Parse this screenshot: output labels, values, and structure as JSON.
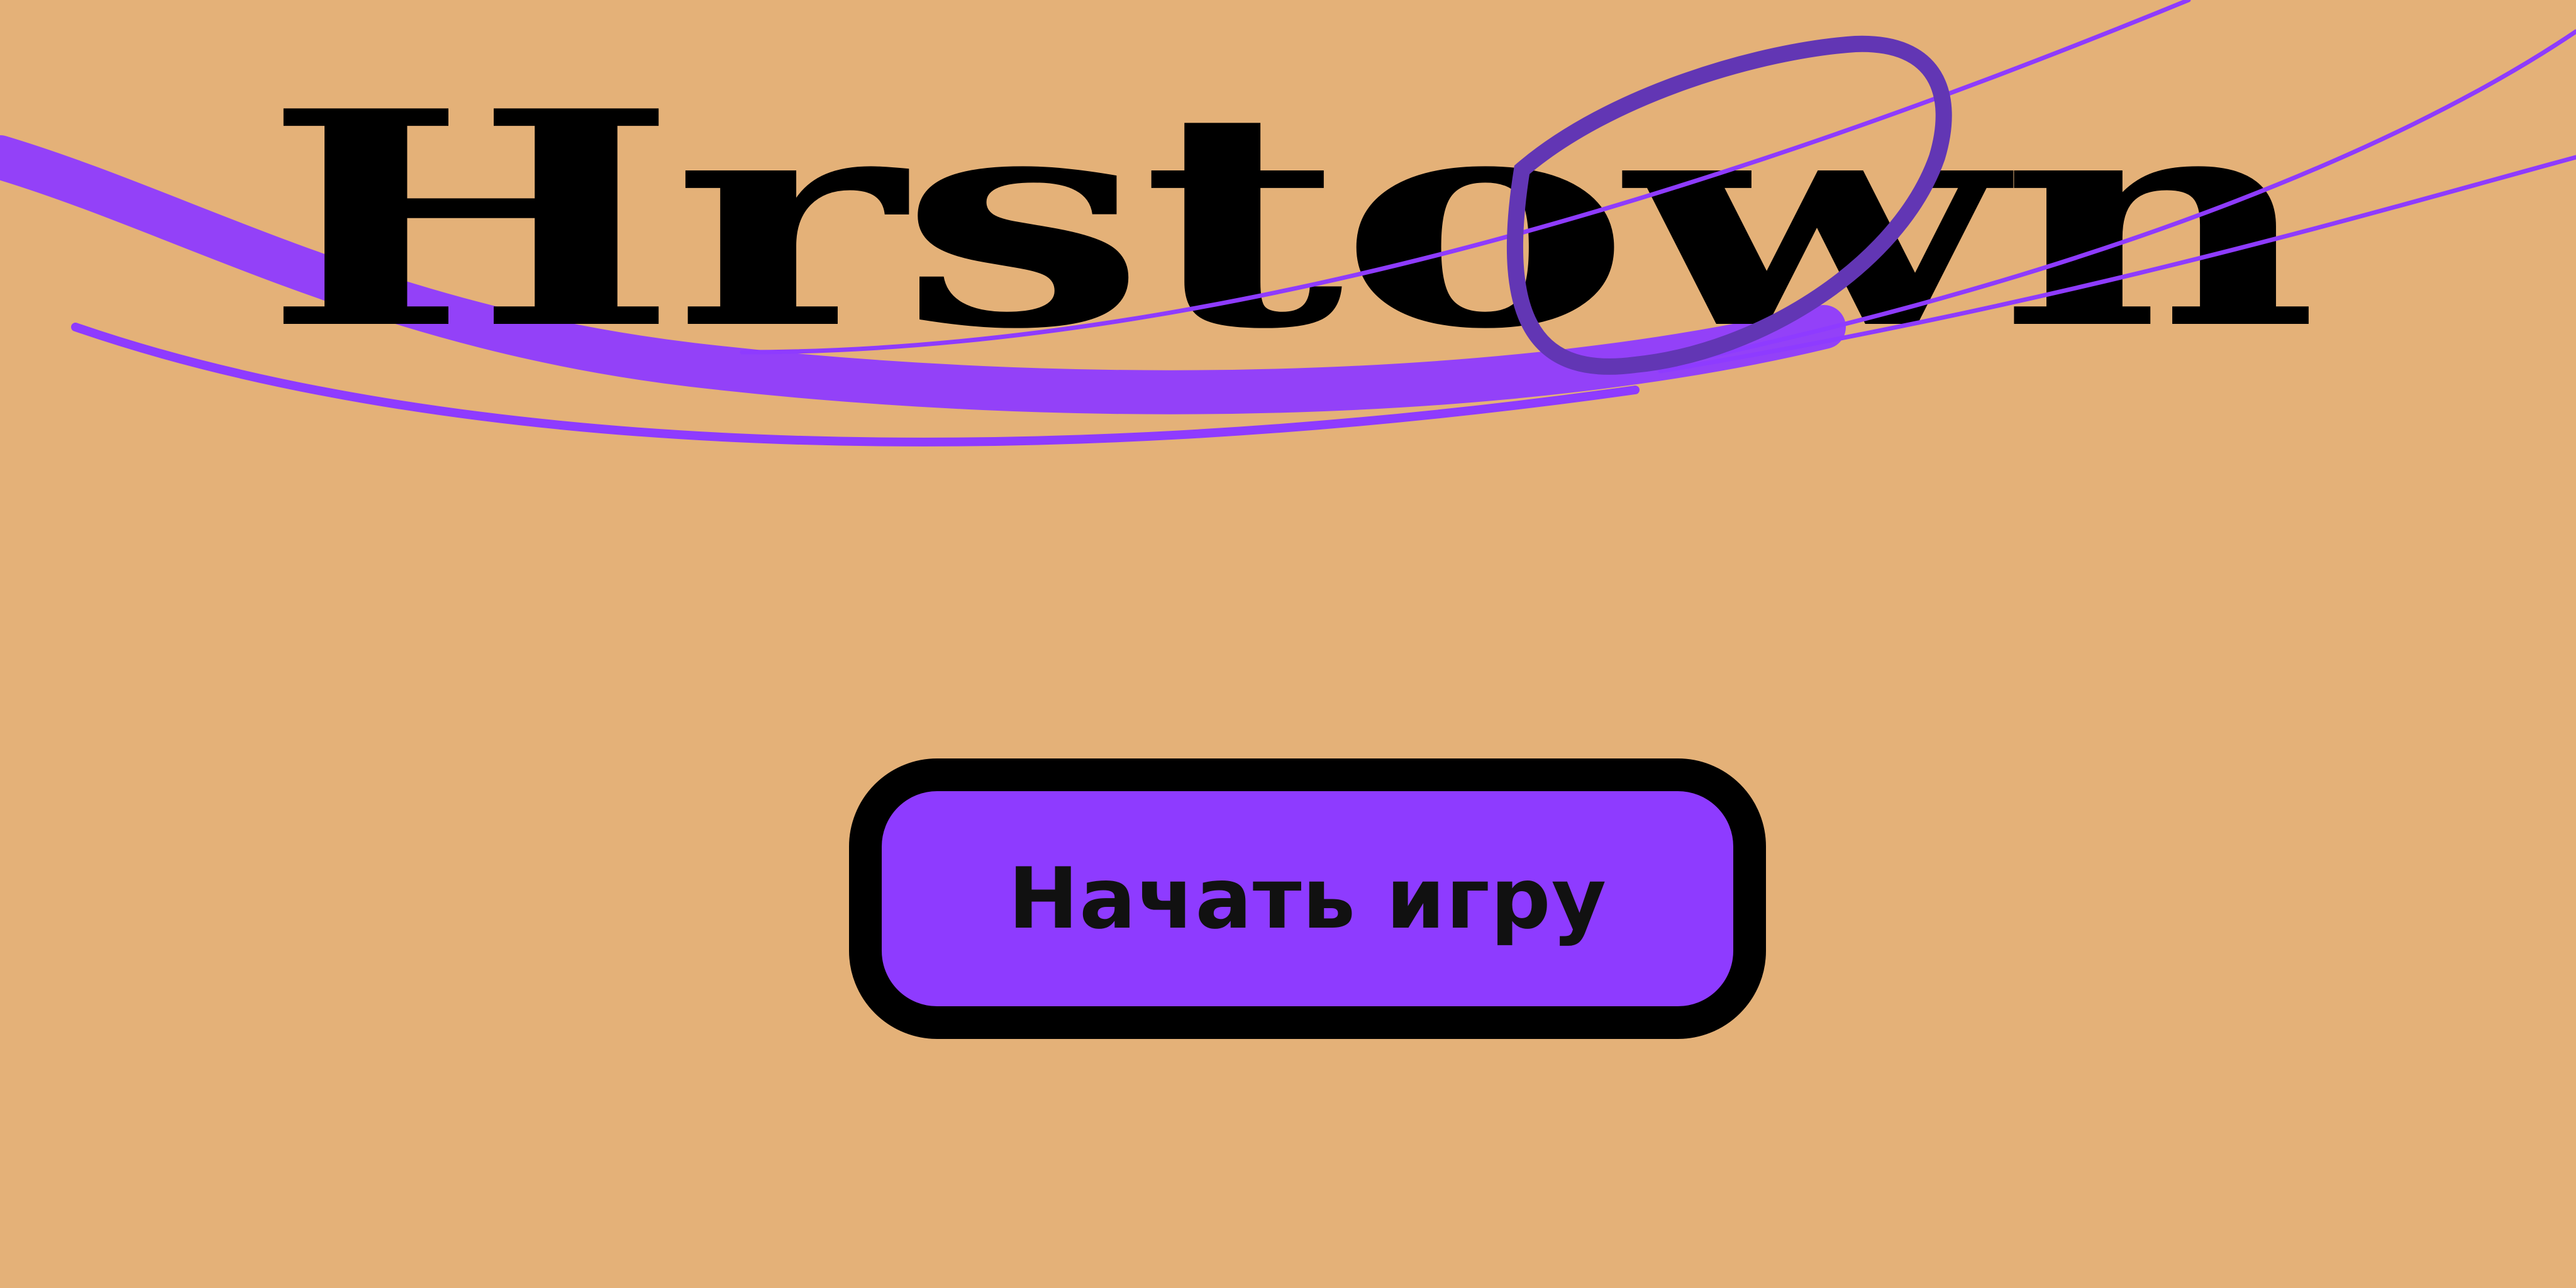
{
  "title": {
    "text": "Hrstown"
  },
  "menu": {
    "start_label": "Начать игру"
  },
  "colors": {
    "background": "#E4B178",
    "accent": "#8E3BFF",
    "accent_dark": "#6236B4",
    "ink": "#000000"
  }
}
